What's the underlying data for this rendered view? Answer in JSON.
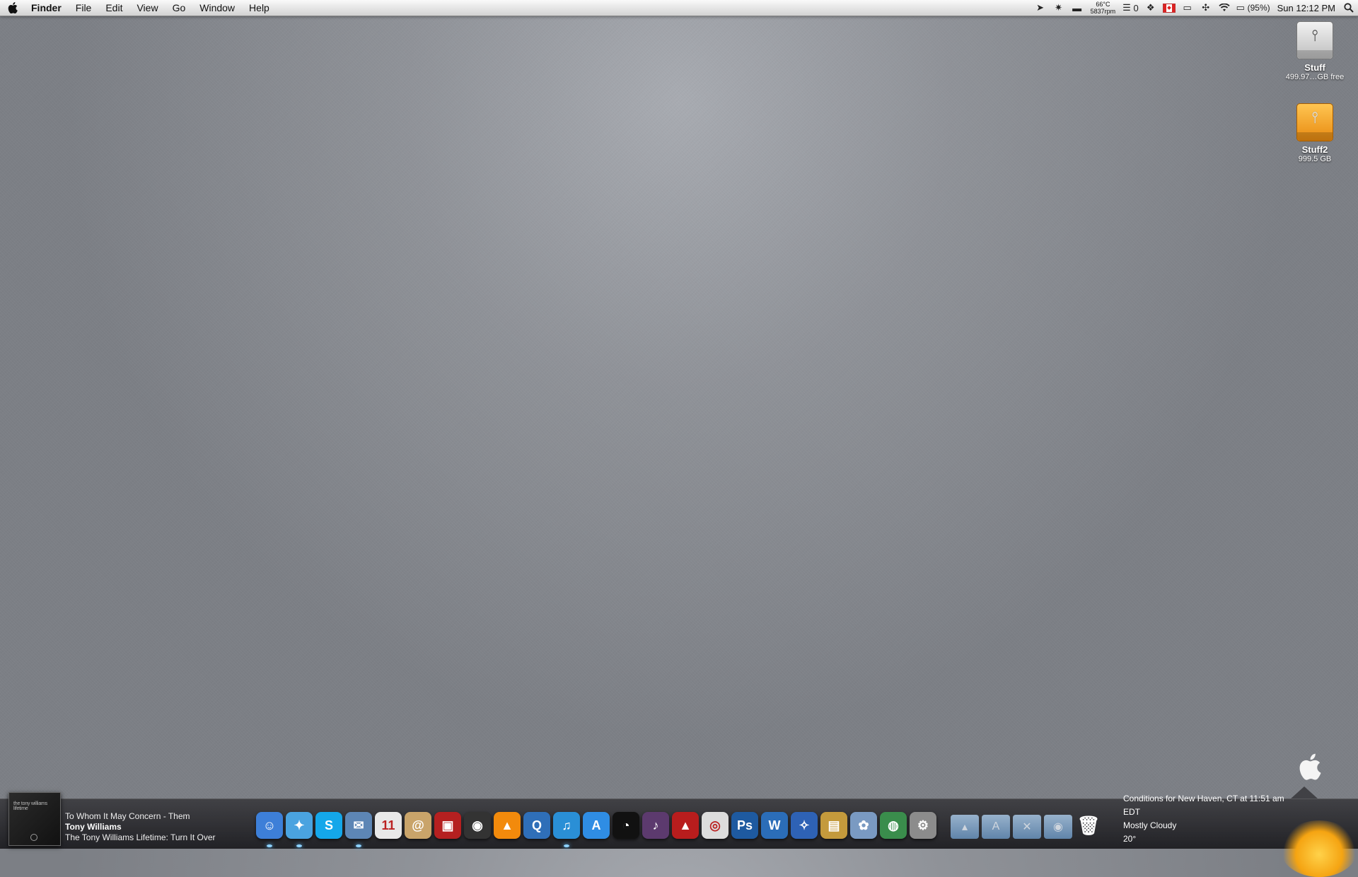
{
  "menubar": {
    "app_name": "Finder",
    "menus": [
      "File",
      "Edit",
      "View",
      "Go",
      "Window",
      "Help"
    ],
    "status": {
      "temperature": "66°C",
      "fan_speed": "5837rpm",
      "notes_count": "0",
      "flag_label": "CAN",
      "battery": "(95%)",
      "clock": "Sun 12:12 PM"
    }
  },
  "desktop": {
    "drives": [
      {
        "name": "Stuff",
        "size": "499.97…GB free"
      },
      {
        "name": "Stuff2",
        "size": "999.5 GB"
      }
    ]
  },
  "now_playing": {
    "album_art_text": "the tony williams lifetime",
    "track": "To Whom It May Concern - Them",
    "artist": "Tony Williams",
    "album": "The Tony Williams Lifetime: Turn It Over"
  },
  "dock": {
    "apps": [
      {
        "name": "finder",
        "glyph": "☺",
        "color": "#3d7fd8",
        "running": true
      },
      {
        "name": "safari",
        "glyph": "✦",
        "color": "#4aa3e0",
        "running": true
      },
      {
        "name": "skype",
        "glyph": "S",
        "color": "#14a7ea",
        "running": false
      },
      {
        "name": "mail",
        "glyph": "✉",
        "color": "#5d86b5",
        "running": true
      },
      {
        "name": "ical",
        "glyph": "11",
        "color": "#e8e8e8",
        "running": false
      },
      {
        "name": "address-book",
        "glyph": "@",
        "color": "#c9a46a",
        "running": false
      },
      {
        "name": "photo-booth",
        "glyph": "▣",
        "color": "#b52020",
        "running": false
      },
      {
        "name": "facetime",
        "glyph": "◉",
        "color": "#333333",
        "running": false
      },
      {
        "name": "vlc",
        "glyph": "▲",
        "color": "#f28a0c",
        "running": false
      },
      {
        "name": "quicktime",
        "glyph": "Q",
        "color": "#2f6fb8",
        "running": false
      },
      {
        "name": "itunes",
        "glyph": "♫",
        "color": "#2a8fd6",
        "running": true
      },
      {
        "name": "app-store",
        "glyph": "A",
        "color": "#2f8de4",
        "running": false
      },
      {
        "name": "ableton-live",
        "glyph": "◔",
        "color": "#111111",
        "running": false
      },
      {
        "name": "sibelius",
        "glyph": "♪",
        "color": "#5c3a6e",
        "running": false
      },
      {
        "name": "automap",
        "glyph": "▲",
        "color": "#b81d1d",
        "running": false
      },
      {
        "name": "max",
        "glyph": "◎",
        "color": "#dcdcdc",
        "running": false
      },
      {
        "name": "photoshop",
        "glyph": "Ps",
        "color": "#1e5aa0",
        "running": false
      },
      {
        "name": "word",
        "glyph": "W",
        "color": "#2b6db8",
        "running": false
      },
      {
        "name": "cyberduck",
        "glyph": "✧",
        "color": "#2e62b5",
        "running": false
      },
      {
        "name": "preview",
        "glyph": "▤",
        "color": "#c49a3c",
        "running": false
      },
      {
        "name": "iphoto",
        "glyph": "✿",
        "color": "#7a9ac2",
        "running": false
      },
      {
        "name": "network-globe",
        "glyph": "◍",
        "color": "#3a8d4c",
        "running": false
      },
      {
        "name": "system-preferences",
        "glyph": "⚙",
        "color": "#8c8c8c",
        "running": false
      }
    ],
    "stacks": [
      {
        "name": "applications-stack",
        "glyph": "▴"
      },
      {
        "name": "app-store-stack",
        "glyph": "A"
      },
      {
        "name": "utilities-stack",
        "glyph": "✕"
      },
      {
        "name": "downloads-stack",
        "glyph": "◉"
      }
    ],
    "trash_glyph": "🗑"
  },
  "weather": {
    "location": "Conditions for New Haven, CT at 11:51 am EDT",
    "conditions": "Mostly Cloudy",
    "temperature": "20°"
  }
}
